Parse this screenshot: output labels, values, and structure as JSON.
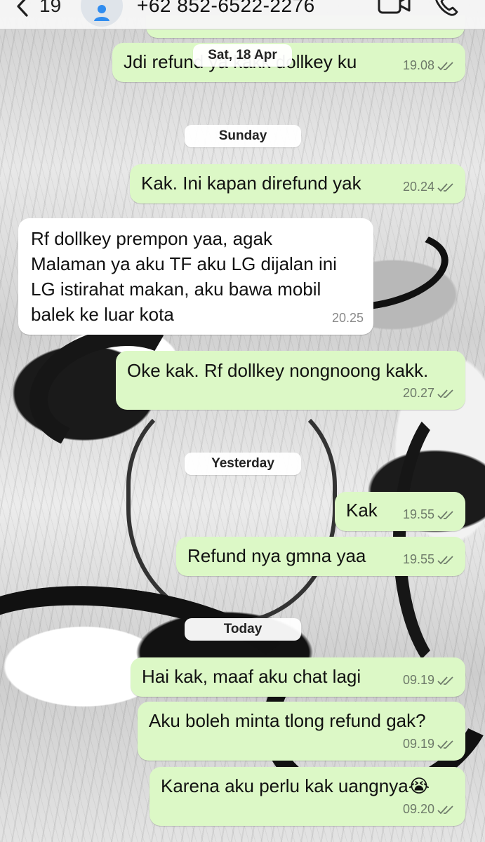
{
  "header": {
    "unread_count": "19",
    "contact_name": "+62 852-6522-2276"
  },
  "date_separators": {
    "sat": "Sat, 18 Apr",
    "sunday": "Sunday",
    "yesterday": "Yesterday",
    "today": "Today"
  },
  "messages": [
    {
      "direction": "outgoing",
      "text": "Jdi refund ya kakk dollkey ku",
      "time": "19.08",
      "status": "read"
    },
    {
      "direction": "outgoing",
      "text": "Kak. Ini kapan direfund yak",
      "time": "20.24",
      "status": "read"
    },
    {
      "direction": "incoming",
      "lines": [
        "Rf dollkey prempon yaa, agak",
        "Malaman ya aku TF aku LG dijalan ini",
        "LG istirahat makan, aku bawa mobil",
        "balek ke luar kota"
      ],
      "time": "20.25"
    },
    {
      "direction": "outgoing",
      "text": "Oke kak. Rf dollkey nongnoong kakk.",
      "time": "20.27",
      "status": "read"
    },
    {
      "direction": "outgoing",
      "text": "Kak",
      "time": "19.55",
      "status": "read"
    },
    {
      "direction": "outgoing",
      "text": "Refund nya gmna yaa",
      "time": "19.55",
      "status": "read"
    },
    {
      "direction": "outgoing",
      "text": "Hai kak, maaf aku chat lagi",
      "time": "09.19",
      "status": "read"
    },
    {
      "direction": "outgoing",
      "text": "Aku boleh minta tlong refund gak?",
      "time": "09.19",
      "status": "read"
    },
    {
      "direction": "outgoing",
      "text": "Karena aku perlu kak uangnya😭",
      "time": "09.20",
      "status": "read"
    }
  ],
  "colors": {
    "outgoing_bubble": "#dcf8c6",
    "incoming_bubble": "#ffffff",
    "read_ticks": "#6e7a6a"
  },
  "icons": [
    "back-chevron-icon",
    "contact-avatar-icon",
    "video-call-icon",
    "phone-call-icon",
    "double-check-icon"
  ]
}
